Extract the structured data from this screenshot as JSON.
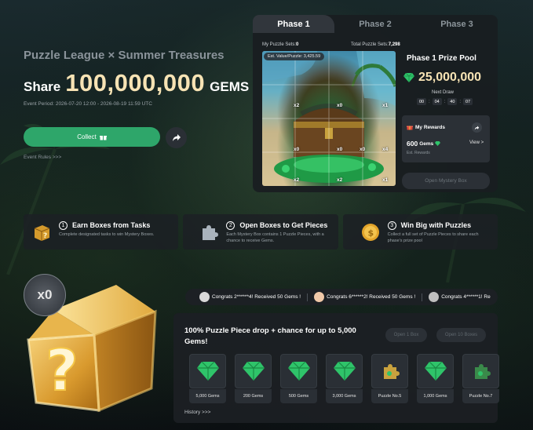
{
  "hero": {
    "subtitle": "Puzzle League × Summer Treasures",
    "share_label": "Share",
    "amount": "100,000,000",
    "currency": "GEMS",
    "period": "Event Period: 2026-07-20 12:00 - 2026-08-19 11:59 UTC",
    "collect_label": "Collect",
    "event_rules": "Event Rules >>>"
  },
  "tabs": [
    "Phase 1",
    "Phase 2",
    "Phase 3"
  ],
  "puzzle": {
    "my_sets_label": "My Puzzle Sets:",
    "my_sets_value": "0",
    "total_sets_label": "Total Puzzle Sets:",
    "total_sets_value": "7,298",
    "est_value": "Est. Value/Puzzle: 3,425.59",
    "pieces": [
      "x2",
      "x0",
      "x1",
      "x0",
      "x0",
      "x0",
      "x4",
      "x2",
      "x2",
      "x1"
    ]
  },
  "prize_pool": {
    "title": "Phase 1 Prize Pool",
    "amount": "25,000,000",
    "next_draw_label": "Next Draw",
    "countdown": [
      "00",
      "04",
      "40",
      "07"
    ]
  },
  "rewards": {
    "title": "My Rewards",
    "gems_value": "600",
    "gems_label": "Gems",
    "view_label": "View >",
    "est_label": "Est. Rewards",
    "open_mystery": "Open Mystery Box"
  },
  "steps": [
    {
      "num": "1",
      "title": "Earn Boxes from Tasks",
      "desc": "Complete designated tasks to win Mystery Boxes."
    },
    {
      "num": "2",
      "title": "Open Boxes to Get Pieces",
      "desc": "Each Mystery Box contains 1 Puzzle Pieces, with a chance to receive Gems."
    },
    {
      "num": "3",
      "title": "Win Big with Puzzles",
      "desc": "Collect a full set of Puzzle Pieces to share each phase's prize pool"
    }
  ],
  "box": {
    "count": "x0"
  },
  "ticker": [
    "Congrats 2******4! Received 50 Gems !",
    "Congrats 6******2! Received 50 Gems !",
    "Congrats 4******1! Re"
  ],
  "draw": {
    "title": "100% Puzzle Piece drop + chance for up to 5,000 Gems!",
    "open_one": "Open 1 Box",
    "open_ten": "Open 10 Boxes",
    "prizes": [
      {
        "label": "5,000 Gems",
        "icon": "gem-icon"
      },
      {
        "label": "200 Gems",
        "icon": "gem-icon"
      },
      {
        "label": "500 Gems",
        "icon": "gem-icon"
      },
      {
        "label": "3,000 Gems",
        "icon": "gem-icon"
      },
      {
        "label": "Puzzle No.5",
        "icon": "puzzle-piece-icon"
      },
      {
        "label": "1,000 Gems",
        "icon": "gem-icon"
      },
      {
        "label": "Puzzle No.7",
        "icon": "puzzle-piece-icon"
      }
    ],
    "history": "History >>>"
  },
  "colors": {
    "accent_green": "#2ea66a",
    "gold_text": "#f7e3b4",
    "panel_bg": "#191d21"
  }
}
